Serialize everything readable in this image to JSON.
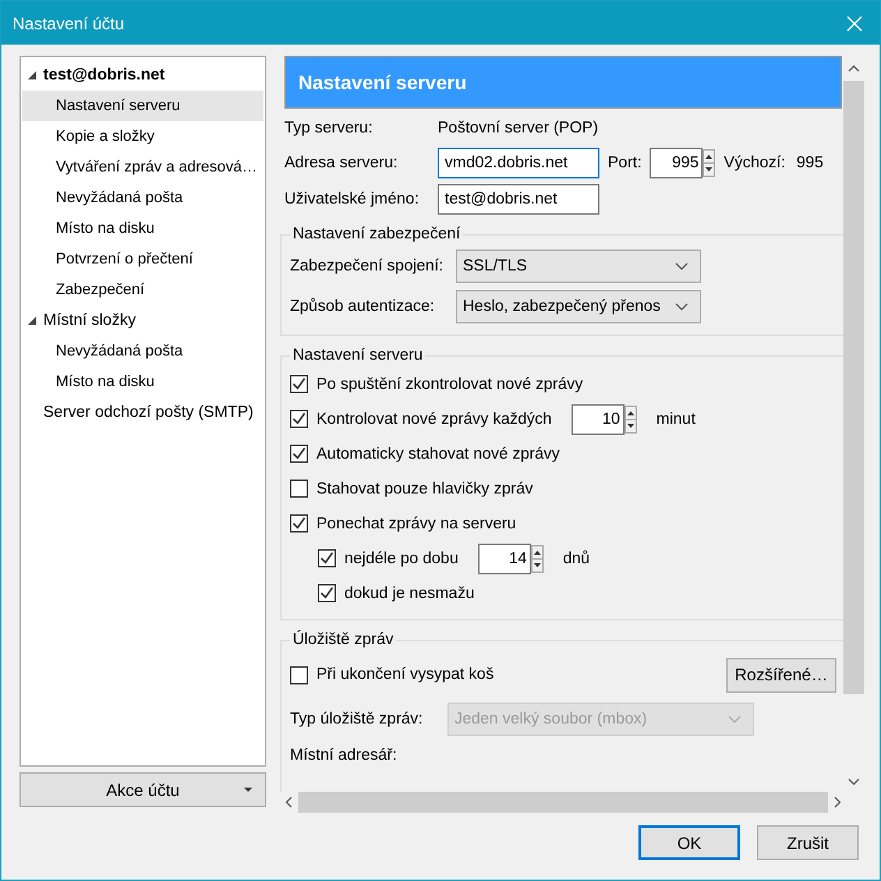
{
  "window": {
    "title": "Nastavení účtu"
  },
  "tree": [
    {
      "kind": "account",
      "label": "test@dobris.net",
      "expanded": true,
      "selected": false,
      "children": [
        {
          "label": "Nastavení serveru",
          "selected": true
        },
        {
          "label": "Kopie a složky",
          "selected": false
        },
        {
          "label": "Vytváření zpráv a adresová…",
          "selected": false
        },
        {
          "label": "Nevyžádaná pošta",
          "selected": false
        },
        {
          "label": "Místo na disku",
          "selected": false
        },
        {
          "label": "Potvrzení o přečtení",
          "selected": false
        },
        {
          "label": "Zabezpečení",
          "selected": false
        }
      ]
    },
    {
      "kind": "folder",
      "label": "Místní složky",
      "expanded": true,
      "selected": false,
      "children": [
        {
          "label": "Nevyžádaná pošta",
          "selected": false
        },
        {
          "label": "Místo na disku",
          "selected": false
        }
      ]
    },
    {
      "kind": "folder",
      "label": "Server odchozí pošty (SMTP)",
      "selected": false
    }
  ],
  "account_actions": {
    "label": "Akce účtu"
  },
  "panel": {
    "header": "Nastavení serveru",
    "server_type_label": "Typ serveru:",
    "server_type_value": "Poštovní server (POP)",
    "address_label": "Adresa serveru:",
    "address_value": "vmd02.dobris.net",
    "port_label": "Port:",
    "port_value": "995",
    "default_label": "Výchozí:",
    "default_value": "995",
    "username_label": "Uživatelské jméno:",
    "username_value": "test@dobris.net"
  },
  "security": {
    "legend": "Nastavení zabezpečení",
    "rows": [
      {
        "label": "Zabezpečení spojení:",
        "value": "SSL/TLS"
      },
      {
        "label": "Způsob autentizace:",
        "value": "Heslo, zabezpečený přenos"
      }
    ]
  },
  "server_settings": {
    "legend": "Nastavení serveru",
    "options": [
      {
        "label": "Po spuštění zkontrolovat nové zprávy",
        "checked": true
      },
      {
        "label": "Kontrolovat nové zprávy každých",
        "checked": true,
        "spin_value": "10",
        "spin_unit": "minut"
      },
      {
        "label": "Automaticky stahovat nové zprávy",
        "checked": true
      },
      {
        "label": "Stahovat pouze hlavičky zpráv",
        "checked": false
      },
      {
        "label": "Ponechat zprávy na serveru",
        "checked": true,
        "children": [
          {
            "label": "nejdéle po dobu",
            "checked": true,
            "spin_value": "14",
            "spin_unit": "dnů"
          },
          {
            "label": "dokud je nesmažu",
            "checked": true
          }
        ]
      }
    ]
  },
  "storage": {
    "legend": "Úložiště zpráv",
    "empty_trash": {
      "label": "Při ukončení vysypat koš",
      "checked": false
    },
    "advanced_button": "Rozšířené…",
    "store_type_label": "Typ úložiště zpráv:",
    "store_type_value": "Jeden velký soubor (mbox)",
    "store_type_disabled": true,
    "local_dir_label": "Místní adresář:"
  },
  "buttons": [
    {
      "label": "OK",
      "default": true
    },
    {
      "label": "Zrušit",
      "default": false
    }
  ]
}
